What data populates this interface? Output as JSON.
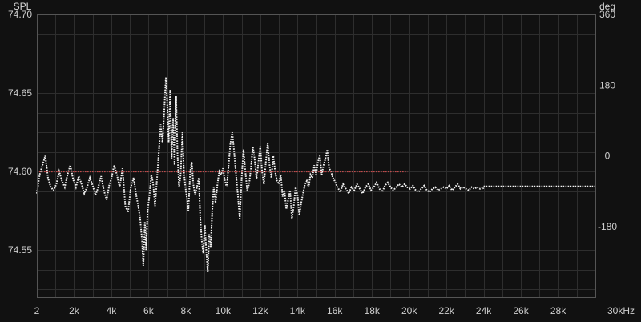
{
  "chart_data": {
    "type": "line",
    "left_axis_title": "SPL",
    "right_axis_title": "deg",
    "x_unit_label": "kHz",
    "xlim": [
      0,
      30000
    ],
    "ylim_left": [
      74.52,
      74.7
    ],
    "ylim_right": [
      -360,
      360
    ],
    "x_ticks": [
      {
        "value": 0,
        "label": "2"
      },
      {
        "value": 2000,
        "label": "2k"
      },
      {
        "value": 4000,
        "label": "4k"
      },
      {
        "value": 6000,
        "label": "6k"
      },
      {
        "value": 8000,
        "label": "8k"
      },
      {
        "value": 10000,
        "label": "10k"
      },
      {
        "value": 12000,
        "label": "12k"
      },
      {
        "value": 14000,
        "label": "14k"
      },
      {
        "value": 16000,
        "label": "16k"
      },
      {
        "value": 18000,
        "label": "18k"
      },
      {
        "value": 20000,
        "label": "20k"
      },
      {
        "value": 22000,
        "label": "22k"
      },
      {
        "value": 24000,
        "label": "24k"
      },
      {
        "value": 26000,
        "label": "26k"
      },
      {
        "value": 28000,
        "label": "28k"
      },
      {
        "value": 30000,
        "label": "30kHz"
      }
    ],
    "left_ticks": [
      {
        "value": 74.7,
        "label": "74.70"
      },
      {
        "value": 74.65,
        "label": "74.65"
      },
      {
        "value": 74.6,
        "label": "74.60"
      },
      {
        "value": 74.55,
        "label": "74.55"
      }
    ],
    "right_ticks": [
      {
        "value": 360,
        "label": "360"
      },
      {
        "value": 180,
        "label": "180"
      },
      {
        "value": 0,
        "label": "0"
      },
      {
        "value": -180,
        "label": "-180"
      }
    ],
    "grid": true,
    "series": [
      {
        "role": "spl-trace",
        "color": "#f2f2f2",
        "points": [
          [
            0,
            74.586
          ],
          [
            150,
            74.598
          ],
          [
            300,
            74.604
          ],
          [
            450,
            74.61
          ],
          [
            600,
            74.596
          ],
          [
            750,
            74.59
          ],
          [
            900,
            74.588
          ],
          [
            1050,
            74.592
          ],
          [
            1200,
            74.6
          ],
          [
            1350,
            74.594
          ],
          [
            1500,
            74.59
          ],
          [
            1650,
            74.598
          ],
          [
            1800,
            74.604
          ],
          [
            1950,
            74.595
          ],
          [
            2100,
            74.59
          ],
          [
            2250,
            74.597
          ],
          [
            2400,
            74.592
          ],
          [
            2550,
            74.586
          ],
          [
            2700,
            74.59
          ],
          [
            2850,
            74.596
          ],
          [
            3000,
            74.591
          ],
          [
            3150,
            74.585
          ],
          [
            3300,
            74.59
          ],
          [
            3450,
            74.597
          ],
          [
            3600,
            74.588
          ],
          [
            3750,
            74.582
          ],
          [
            3900,
            74.592
          ],
          [
            4000,
            74.595
          ],
          [
            4150,
            74.604
          ],
          [
            4300,
            74.598
          ],
          [
            4450,
            74.59
          ],
          [
            4600,
            74.602
          ],
          [
            4750,
            74.578
          ],
          [
            4900,
            74.574
          ],
          [
            5050,
            74.59
          ],
          [
            5200,
            74.596
          ],
          [
            5350,
            74.584
          ],
          [
            5450,
            74.578
          ],
          [
            5550,
            74.57
          ],
          [
            5650,
            74.556
          ],
          [
            5720,
            74.54
          ],
          [
            5800,
            74.568
          ],
          [
            5870,
            74.55
          ],
          [
            5950,
            74.575
          ],
          [
            6050,
            74.585
          ],
          [
            6150,
            74.598
          ],
          [
            6250,
            74.592
          ],
          [
            6350,
            74.578
          ],
          [
            6450,
            74.595
          ],
          [
            6550,
            74.612
          ],
          [
            6650,
            74.63
          ],
          [
            6750,
            74.618
          ],
          [
            6850,
            74.64
          ],
          [
            6930,
            74.66
          ],
          [
            7000,
            74.645
          ],
          [
            7080,
            74.618
          ],
          [
            7160,
            74.652
          ],
          [
            7240,
            74.608
          ],
          [
            7320,
            74.634
          ],
          [
            7400,
            74.604
          ],
          [
            7480,
            74.648
          ],
          [
            7560,
            74.61
          ],
          [
            7640,
            74.59
          ],
          [
            7720,
            74.598
          ],
          [
            7820,
            74.625
          ],
          [
            7900,
            74.6
          ],
          [
            7980,
            74.59
          ],
          [
            8060,
            74.583
          ],
          [
            8140,
            74.575
          ],
          [
            8240,
            74.6
          ],
          [
            8320,
            74.606
          ],
          [
            8400,
            74.592
          ],
          [
            8500,
            74.585
          ],
          [
            8600,
            74.59
          ],
          [
            8700,
            74.596
          ],
          [
            8780,
            74.57
          ],
          [
            8860,
            74.556
          ],
          [
            8940,
            74.548
          ],
          [
            9020,
            74.566
          ],
          [
            9100,
            74.55
          ],
          [
            9180,
            74.536
          ],
          [
            9260,
            74.56
          ],
          [
            9340,
            74.552
          ],
          [
            9420,
            74.575
          ],
          [
            9500,
            74.59
          ],
          [
            9600,
            74.58
          ],
          [
            9700,
            74.592
          ],
          [
            9800,
            74.6
          ],
          [
            9900,
            74.598
          ],
          [
            10000,
            74.602
          ],
          [
            10100,
            74.594
          ],
          [
            10200,
            74.59
          ],
          [
            10300,
            74.604
          ],
          [
            10400,
            74.618
          ],
          [
            10500,
            74.625
          ],
          [
            10600,
            74.612
          ],
          [
            10700,
            74.598
          ],
          [
            10800,
            74.585
          ],
          [
            10900,
            74.57
          ],
          [
            11000,
            74.596
          ],
          [
            11100,
            74.614
          ],
          [
            11200,
            74.6
          ],
          [
            11300,
            74.588
          ],
          [
            11400,
            74.592
          ],
          [
            11500,
            74.602
          ],
          [
            11600,
            74.616
          ],
          [
            11700,
            74.608
          ],
          [
            11800,
            74.595
          ],
          [
            11900,
            74.606
          ],
          [
            12000,
            74.616
          ],
          [
            12100,
            74.6
          ],
          [
            12200,
            74.592
          ],
          [
            12300,
            74.606
          ],
          [
            12400,
            74.618
          ],
          [
            12500,
            74.604
          ],
          [
            12600,
            74.596
          ],
          [
            12700,
            74.61
          ],
          [
            12800,
            74.6
          ],
          [
            12900,
            74.594
          ],
          [
            13000,
            74.592
          ],
          [
            13100,
            74.598
          ],
          [
            13200,
            74.584
          ],
          [
            13300,
            74.588
          ],
          [
            13400,
            74.576
          ],
          [
            13500,
            74.582
          ],
          [
            13600,
            74.588
          ],
          [
            13700,
            74.57
          ],
          [
            13800,
            74.578
          ],
          [
            13900,
            74.59
          ],
          [
            14000,
            74.585
          ],
          [
            14100,
            74.572
          ],
          [
            14200,
            74.58
          ],
          [
            14300,
            74.586
          ],
          [
            14400,
            74.592
          ],
          [
            14500,
            74.594
          ],
          [
            14600,
            74.59
          ],
          [
            14700,
            74.598
          ],
          [
            14800,
            74.596
          ],
          [
            14900,
            74.604
          ],
          [
            15000,
            74.598
          ],
          [
            15100,
            74.606
          ],
          [
            15200,
            74.61
          ],
          [
            15300,
            74.598
          ],
          [
            15400,
            74.604
          ],
          [
            15500,
            74.608
          ],
          [
            15600,
            74.614
          ],
          [
            15700,
            74.602
          ],
          [
            15800,
            74.6
          ],
          [
            15900,
            74.596
          ],
          [
            16000,
            74.594
          ],
          [
            16150,
            74.59
          ],
          [
            16300,
            74.587
          ],
          [
            16450,
            74.592
          ],
          [
            16600,
            74.589
          ],
          [
            16750,
            74.586
          ],
          [
            16900,
            74.59
          ],
          [
            17050,
            74.588
          ],
          [
            17200,
            74.592
          ],
          [
            17350,
            74.589
          ],
          [
            17500,
            74.586
          ],
          [
            17650,
            74.59
          ],
          [
            17800,
            74.592
          ],
          [
            17950,
            74.588
          ],
          [
            18100,
            74.59
          ],
          [
            18250,
            74.593
          ],
          [
            18400,
            74.589
          ],
          [
            18550,
            74.587
          ],
          [
            18700,
            74.591
          ],
          [
            18850,
            74.593
          ],
          [
            19000,
            74.59
          ],
          [
            19150,
            74.588
          ],
          [
            19300,
            74.59
          ],
          [
            19450,
            74.592
          ],
          [
            19600,
            74.59
          ],
          [
            19750,
            74.592
          ],
          [
            19900,
            74.59
          ],
          [
            20050,
            74.589
          ],
          [
            20200,
            74.591
          ],
          [
            20350,
            74.588
          ],
          [
            20500,
            74.587
          ],
          [
            20650,
            74.589
          ],
          [
            20800,
            74.591
          ],
          [
            20950,
            74.588
          ],
          [
            21100,
            74.587
          ],
          [
            21250,
            74.589
          ],
          [
            21400,
            74.59
          ],
          [
            21550,
            74.588
          ],
          [
            21700,
            74.589
          ],
          [
            21850,
            74.59
          ],
          [
            22000,
            74.589
          ],
          [
            22150,
            74.591
          ],
          [
            22300,
            74.588
          ],
          [
            22450,
            74.59
          ],
          [
            22600,
            74.592
          ],
          [
            22750,
            74.589
          ],
          [
            22900,
            74.59
          ],
          [
            23050,
            74.589
          ],
          [
            23200,
            74.588
          ],
          [
            23350,
            74.59
          ],
          [
            23500,
            74.589
          ],
          [
            23650,
            74.59
          ],
          [
            23800,
            74.589
          ],
          [
            23950,
            74.59
          ],
          [
            24000,
            74.589
          ]
        ]
      },
      {
        "role": "flat-extension",
        "color": "#f2f2f2",
        "points": [
          [
            24000,
            74.5905
          ],
          [
            30000,
            74.5905
          ]
        ]
      },
      {
        "role": "reference-line",
        "color": "#c04a4a",
        "points": [
          [
            0,
            74.6
          ],
          [
            19900,
            74.6
          ]
        ]
      }
    ]
  }
}
